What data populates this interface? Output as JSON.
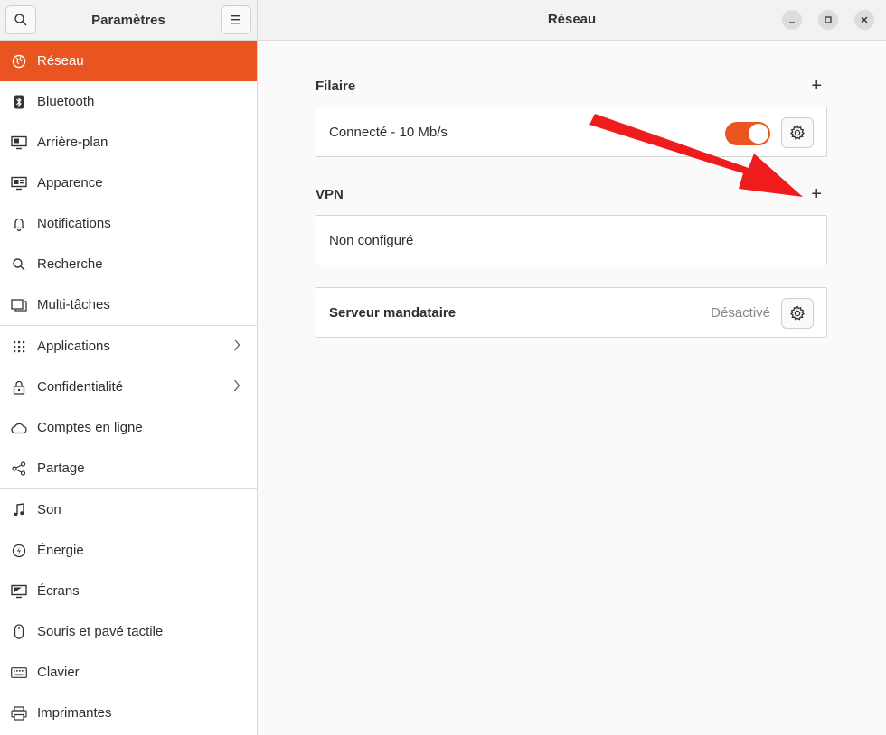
{
  "sidebar": {
    "title": "Paramètres",
    "items": [
      {
        "label": "Réseau",
        "icon": "globe-icon",
        "active": true
      },
      {
        "label": "Bluetooth",
        "icon": "bluetooth-icon"
      },
      {
        "label": "Arrière-plan",
        "icon": "monitor-icon"
      },
      {
        "label": "Apparence",
        "icon": "appearance-icon"
      },
      {
        "label": "Notifications",
        "icon": "bell-icon"
      },
      {
        "label": "Recherche",
        "icon": "search-icon"
      },
      {
        "label": "Multi-tâches",
        "icon": "multitask-icon"
      },
      {
        "label": "Applications",
        "icon": "grid-icon"
      },
      {
        "label": "Confidentialité",
        "icon": "lock-icon"
      },
      {
        "label": "Comptes en ligne",
        "icon": "cloud-icon"
      },
      {
        "label": "Partage",
        "icon": "share-icon"
      },
      {
        "label": "Son",
        "icon": "music-note-icon"
      },
      {
        "label": "Énergie",
        "icon": "power-icon"
      },
      {
        "label": "Écrans",
        "icon": "display-icon"
      },
      {
        "label": "Souris et pavé tactile",
        "icon": "mouse-icon"
      },
      {
        "label": "Clavier",
        "icon": "keyboard-icon"
      },
      {
        "label": "Imprimantes",
        "icon": "printer-icon"
      }
    ]
  },
  "main": {
    "title": "Réseau",
    "wired": {
      "heading": "Filaire",
      "connection_label": "Connecté - 10 Mb/s",
      "enabled": true
    },
    "vpn": {
      "heading": "VPN",
      "status_label": "Non configuré"
    },
    "proxy": {
      "label": "Serveur mandataire",
      "status": "Désactivé"
    }
  },
  "colors": {
    "accent": "#e95420",
    "annotation_arrow": "#ee1c1c"
  }
}
